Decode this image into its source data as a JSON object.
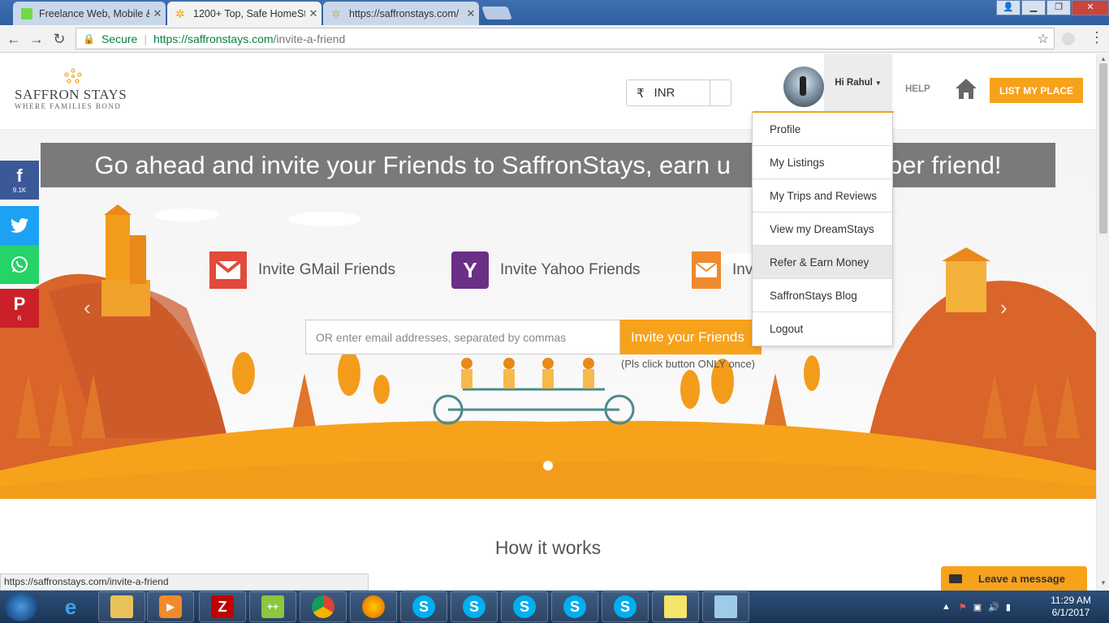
{
  "browser": {
    "tabs": [
      {
        "title": "Freelance Web, Mobile &",
        "active": false,
        "icon": "upwork-icon",
        "icon_color": "#6fda44"
      },
      {
        "title": "1200+ Top, Safe HomeSt",
        "active": true,
        "icon": "saffron-star-icon",
        "icon_color": "#f7a21b"
      },
      {
        "title": "https://saffronstays.com/",
        "active": false,
        "icon": "saffron-star-icon",
        "icon_color": "#c8b38a"
      }
    ],
    "secure_label": "Secure",
    "url_host": "https://saffronstays.com",
    "url_path": "/invite-a-friend"
  },
  "header": {
    "logo_name": "SAFFRON STAYS",
    "logo_tagline": "WHERE FAMILIES BOND",
    "currency_symbol": "₹",
    "currency": "INR",
    "greeting": "Hi Rahul",
    "help": "HELP",
    "list_place": "LIST MY PLACE"
  },
  "user_menu": [
    {
      "label": "Profile",
      "highlighted": false
    },
    {
      "label": "My Listings",
      "highlighted": false
    },
    {
      "label": "My Trips and Reviews",
      "highlighted": false
    },
    {
      "label": "View my DreamStays",
      "highlighted": false
    },
    {
      "label": "Refer & Earn Money",
      "highlighted": true
    },
    {
      "label": "SaffronStays Blog",
      "highlighted": false
    },
    {
      "label": "Logout",
      "highlighted": false
    }
  ],
  "hero": {
    "headline": "Go ahead and invite your Friends to SaffronStays, earn u",
    "headline_tail": "per friend!",
    "invite_gmail": "Invite GMail Friends",
    "invite_yahoo": "Invite Yahoo Friends",
    "invite_outlook": "Invi",
    "email_placeholder": "OR enter email addresses, separated by commas",
    "invite_button": "Invite your Friends",
    "invite_note": "(Pls click button ONLY once)"
  },
  "social": [
    {
      "name": "facebook",
      "glyph": "f",
      "count": "9.1K",
      "color": "#3b5998"
    },
    {
      "name": "twitter",
      "glyph": "t",
      "count": "",
      "color": "#1da1f2"
    },
    {
      "name": "whatsapp",
      "glyph": "w",
      "count": "",
      "color": "#25d366"
    },
    {
      "name": "pinterest",
      "glyph": "P",
      "count": "6",
      "color": "#cb2027"
    }
  ],
  "section_title": "How it works",
  "status_url": "https://saffronstays.com/invite-a-friend",
  "chat_label": "Leave a message",
  "taskbar": {
    "time": "11:29 AM",
    "date": "6/1/2017"
  },
  "colors": {
    "accent": "#f7a21b",
    "secure_green": "#0b8043"
  }
}
